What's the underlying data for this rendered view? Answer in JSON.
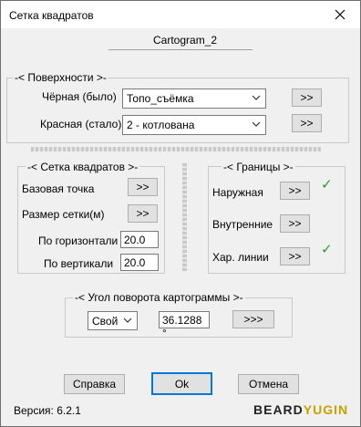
{
  "window": {
    "title": "Сетка квадратов"
  },
  "cartogram_name": "Cartogram_2",
  "surfaces": {
    "legend": "-< Поверхности >-",
    "black": {
      "label": "Чёрная (было)",
      "value": "Топо_съёмка",
      "button": ">>"
    },
    "red": {
      "label": "Красная (стало)",
      "value": "2 - котлована",
      "button": ">>"
    }
  },
  "grid": {
    "legend": "-< Сетка квадратов >-",
    "base_point": {
      "label": "Базовая точка",
      "button": ">>"
    },
    "grid_size": {
      "label": "Размер сетки(м)",
      "button": ">>"
    },
    "horizontal": {
      "label": "По горизонтали",
      "value": "20.0"
    },
    "vertical": {
      "label": "По вертикали",
      "value": "20.0"
    }
  },
  "borders": {
    "legend": "-< Границы >-",
    "outer": {
      "label": "Наружная",
      "button": ">>",
      "checked": true
    },
    "inner": {
      "label": "Внутренние",
      "button": ">>",
      "checked": false
    },
    "char_lines": {
      "label": "Хар. линии",
      "button": ">>",
      "checked": true
    },
    "check_glyph": "✓",
    "check_color": "#2a9a2a"
  },
  "rotation": {
    "legend": "-< Угол поворота картограммы >-",
    "mode": "Свой",
    "angle": "36.1288 °",
    "button": ">>>"
  },
  "footer": {
    "help": "Справка",
    "ok": "Ok",
    "cancel": "Отмена",
    "version": "Версия: 6.2.1",
    "brand_part1": "BEARD",
    "brand_part2": "YUGIN",
    "brand_color1": "#222222",
    "brand_color2": "#c8a000"
  },
  "icons": {
    "close": "close-icon",
    "dropdown": "chevron-down-icon",
    "check": "checkmark-icon"
  }
}
